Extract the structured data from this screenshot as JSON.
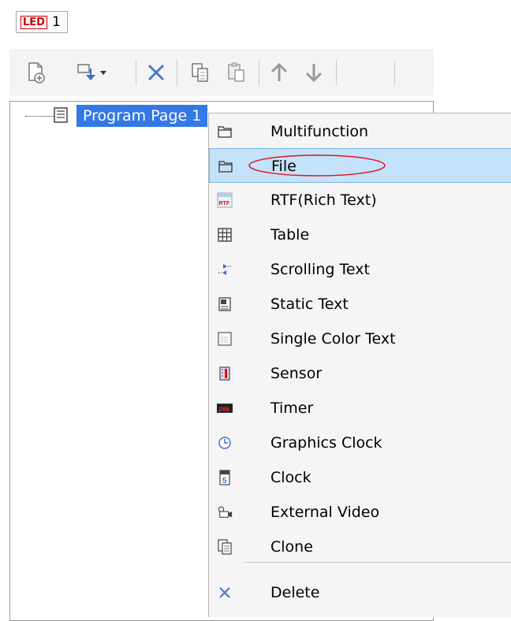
{
  "tab": {
    "badge": "LED",
    "number": "1"
  },
  "toolbar": {
    "buttons": [
      "add-page-icon",
      "add-item-dropdown-icon",
      "delete-icon",
      "copy-icon",
      "paste-icon",
      "move-up-icon",
      "move-down-icon"
    ]
  },
  "tree": {
    "node_label": "Program Page 1"
  },
  "menu": {
    "items": [
      {
        "label": "Multifunction",
        "icon": "folder-icon"
      },
      {
        "label": "File",
        "icon": "folder-icon"
      },
      {
        "label": "RTF(Rich Text)",
        "icon": "rtf-icon"
      },
      {
        "label": "Table",
        "icon": "table-icon"
      },
      {
        "label": "Scrolling Text",
        "icon": "scrolling-text-icon"
      },
      {
        "label": "Static Text",
        "icon": "static-text-icon"
      },
      {
        "label": "Single Color Text",
        "icon": "single-color-text-icon"
      },
      {
        "label": "Sensor",
        "icon": "sensor-icon"
      },
      {
        "label": "Timer",
        "icon": "timer-icon"
      },
      {
        "label": "Graphics Clock",
        "icon": "graphics-clock-icon"
      },
      {
        "label": "Clock",
        "icon": "clock-icon"
      },
      {
        "label": "External Video",
        "icon": "external-video-icon"
      },
      {
        "label": "Clone",
        "icon": "clone-icon"
      },
      {
        "label": "Delete",
        "icon": "delete-icon"
      }
    ],
    "highlighted": "File"
  },
  "colors": {
    "selection": "#3478e6",
    "menu_highlight": "#c5e2fb",
    "accent_red": "#d00000"
  }
}
